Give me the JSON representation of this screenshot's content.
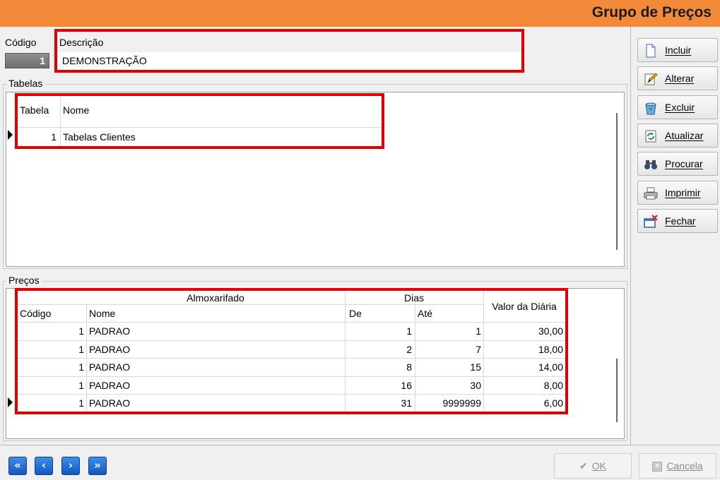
{
  "header": {
    "title": "Grupo de Preços",
    "accent": "#f28a3a"
  },
  "form": {
    "codigo_label": "Código",
    "codigo_value": "1",
    "descricao_label": "Descrição",
    "descricao_value": "DEMONSTRAÇÃO"
  },
  "tabelas": {
    "group_label": "Tabelas",
    "columns": [
      "Tabela",
      "Nome"
    ],
    "rows": [
      {
        "tabela": "1",
        "nome": "Tabelas Clientes"
      }
    ]
  },
  "precos": {
    "group_label": "Preços",
    "header_almox": "Almoxarifado",
    "header_dias": "Dias",
    "header_valor": "Valor da Diária",
    "col_codigo": "Código",
    "col_nome": "Nome",
    "col_de": "De",
    "col_ate": "Até",
    "rows": [
      {
        "codigo": "1",
        "nome": "PADRAO",
        "de": "1",
        "ate": "1",
        "valor": "30,00"
      },
      {
        "codigo": "1",
        "nome": "PADRAO",
        "de": "2",
        "ate": "7",
        "valor": "18,00"
      },
      {
        "codigo": "1",
        "nome": "PADRAO",
        "de": "8",
        "ate": "15",
        "valor": "14,00"
      },
      {
        "codigo": "1",
        "nome": "PADRAO",
        "de": "16",
        "ate": "30",
        "valor": "8,00"
      },
      {
        "codigo": "1",
        "nome": "PADRAO",
        "de": "31",
        "ate": "9999999",
        "valor": "6,00"
      }
    ]
  },
  "toolbar": {
    "incluir": "Incluir",
    "alterar": "Alterar",
    "excluir": "Excluir",
    "atualizar": "Atualizar",
    "procurar": "Procurar",
    "imprimir": "Imprimir",
    "fechar": "Fechar"
  },
  "nav": {
    "first": "«",
    "prev": "‹",
    "next": "›",
    "last": "»"
  },
  "dialog": {
    "ok": "OK",
    "cancela": "Cancela"
  },
  "icons": {
    "incluir": "new-document-icon",
    "alterar": "pencil-edit-icon",
    "excluir": "recycle-bin-icon",
    "atualizar": "refresh-icon",
    "procurar": "binoculars-icon",
    "imprimir": "printer-icon",
    "fechar": "close-window-icon",
    "ok": "checkmark-icon",
    "cancela": "cancel-icon"
  }
}
